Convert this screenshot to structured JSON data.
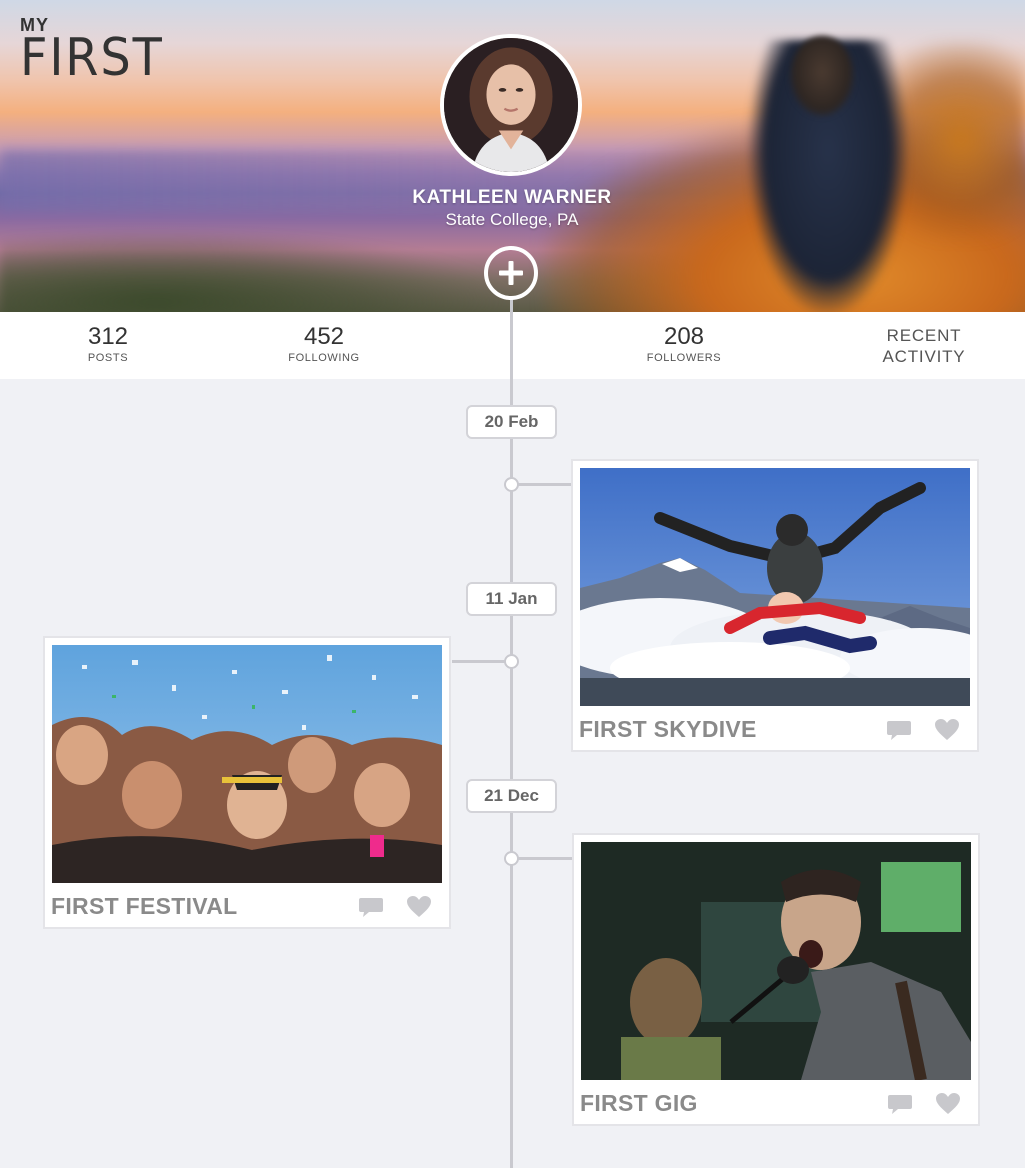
{
  "brand": {
    "top": "MY",
    "bottom": "FIRST"
  },
  "profile": {
    "name": "KATHLEEN WARNER",
    "location": "State College, PA"
  },
  "stats": {
    "posts": {
      "value": "312",
      "label": "POSTS"
    },
    "following": {
      "value": "452",
      "label": "FOLLOWING"
    },
    "followers": {
      "value": "208",
      "label": "FOLLOWERS"
    },
    "recent_activity": {
      "line1": "RECENT",
      "line2": "ACTIVITY"
    }
  },
  "timeline": {
    "dates": [
      "20 Feb",
      "11 Jan",
      "21 Dec"
    ],
    "posts": [
      {
        "title": "FIRST SKYDIVE",
        "side": "right"
      },
      {
        "title": "FIRST FESTIVAL",
        "side": "left"
      },
      {
        "title": "FIRST GIG",
        "side": "right"
      }
    ]
  },
  "icons": {
    "add": "plus-icon",
    "comment": "comment-icon",
    "like": "heart-icon"
  },
  "colors": {
    "background": "#f0f1f5",
    "timeline": "#c9c9cf",
    "card_title": "#8a8a8a",
    "icon": "#c8c8cc"
  }
}
